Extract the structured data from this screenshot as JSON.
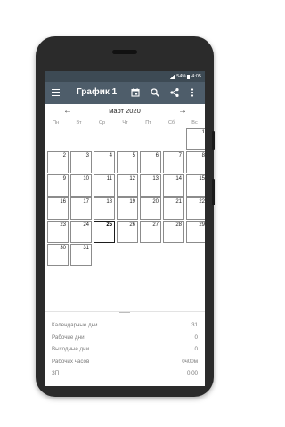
{
  "status_bar": {
    "battery": "54%",
    "time": "4:05"
  },
  "app_bar": {
    "title": "График 1"
  },
  "calendar": {
    "month_label": "март 2020",
    "weekdays": [
      "Пн",
      "Вт",
      "Ср",
      "Чт",
      "Пт",
      "Сб",
      "Вс"
    ],
    "weeks": [
      [
        "",
        "",
        "",
        "",
        "",
        "",
        "1"
      ],
      [
        "2",
        "3",
        "4",
        "5",
        "6",
        "7",
        "8"
      ],
      [
        "9",
        "10",
        "11",
        "12",
        "13",
        "14",
        "15"
      ],
      [
        "16",
        "17",
        "18",
        "19",
        "20",
        "21",
        "22"
      ],
      [
        "23",
        "24",
        "25",
        "26",
        "27",
        "28",
        "29"
      ],
      [
        "30",
        "31",
        "",
        "",
        "",
        "",
        ""
      ]
    ],
    "today": "25"
  },
  "stats": [
    {
      "label": "Календарные дни",
      "value": "31"
    },
    {
      "label": "Рабочие дни",
      "value": "0"
    },
    {
      "label": "Выходные дни",
      "value": "0"
    },
    {
      "label": "Рабочих часов",
      "value": "0ч00м"
    },
    {
      "label": "ЗП",
      "value": "0,00"
    }
  ],
  "colors": {
    "app_bar": "#4e5d6a",
    "status_bar": "#3d4a54",
    "cell_border": "#8c8c8c",
    "today_border": "#1d1d1d"
  },
  "icons": [
    "menu-icon",
    "calendar-today-icon",
    "search-icon",
    "share-icon",
    "more-vert-icon",
    "chevron-left-icon",
    "chevron-right-icon"
  ]
}
